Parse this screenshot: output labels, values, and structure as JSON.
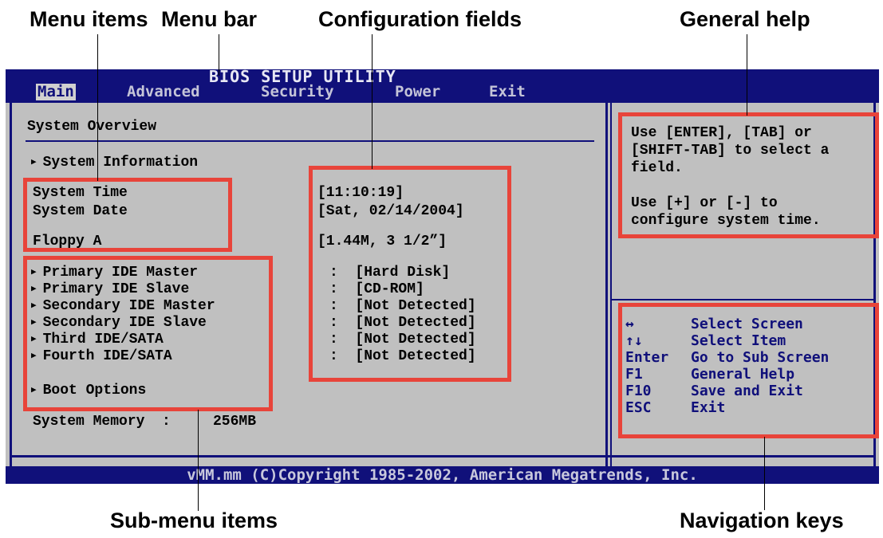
{
  "callouts": {
    "menu_items": "Menu items",
    "menu_bar": "Menu bar",
    "configuration_fields": "Configuration fields",
    "general_help": "General help",
    "sub_menu_items": "Sub-menu items",
    "navigation_keys": "Navigation keys"
  },
  "bios": {
    "title": "BIOS SETUP UTILITY",
    "menu": [
      "Main",
      "Advanced",
      "Security",
      "Power",
      "Exit"
    ],
    "active_menu": "Main",
    "footer": "vMM.mm (C)Copyright 1985-2002, American Megatrends, Inc.",
    "section_title": "System Overview",
    "system_information": "System Information",
    "fields": [
      {
        "label": "System Time",
        "value": "[11:10:19]"
      },
      {
        "label": "System Date",
        "value": "[Sat, 02/14/2004]"
      },
      {
        "label": "Floppy A",
        "value": "[1.44M, 3 1/2”]"
      }
    ],
    "submenus": [
      {
        "label": "Primary IDE Master",
        "value": ":  [Hard Disk]"
      },
      {
        "label": "Primary IDE Slave",
        "value": ":  [CD-ROM]"
      },
      {
        "label": "Secondary IDE Master",
        "value": ":  [Not Detected]"
      },
      {
        "label": "Secondary IDE Slave",
        "value": ":  [Not Detected]"
      },
      {
        "label": "Third IDE/SATA",
        "value": ":  [Not Detected]"
      },
      {
        "label": "Fourth IDE/SATA",
        "value": ":  [Not Detected]"
      }
    ],
    "boot_options": "Boot Options",
    "system_memory": {
      "label": "System Memory  :",
      "value": "256MB"
    },
    "help_lines": [
      "Use [ENTER], [TAB] or",
      "[SHIFT-TAB] to select a",
      "field.",
      "",
      "Use [+] or [-] to",
      "configure system time."
    ],
    "nav_keys": [
      {
        "key": "↔",
        "action": "Select Screen"
      },
      {
        "key": "↑↓",
        "action": "Select Item"
      },
      {
        "key": "Enter",
        "action": "Go to Sub Screen"
      },
      {
        "key": "F1",
        "action": "General Help"
      },
      {
        "key": "F10",
        "action": "Save and Exit"
      },
      {
        "key": "ESC",
        "action": "Exit"
      }
    ]
  },
  "colors": {
    "bios_blue": "#10107a",
    "bios_gray": "#c0c0c0",
    "highlight_red": "#e8443a"
  }
}
